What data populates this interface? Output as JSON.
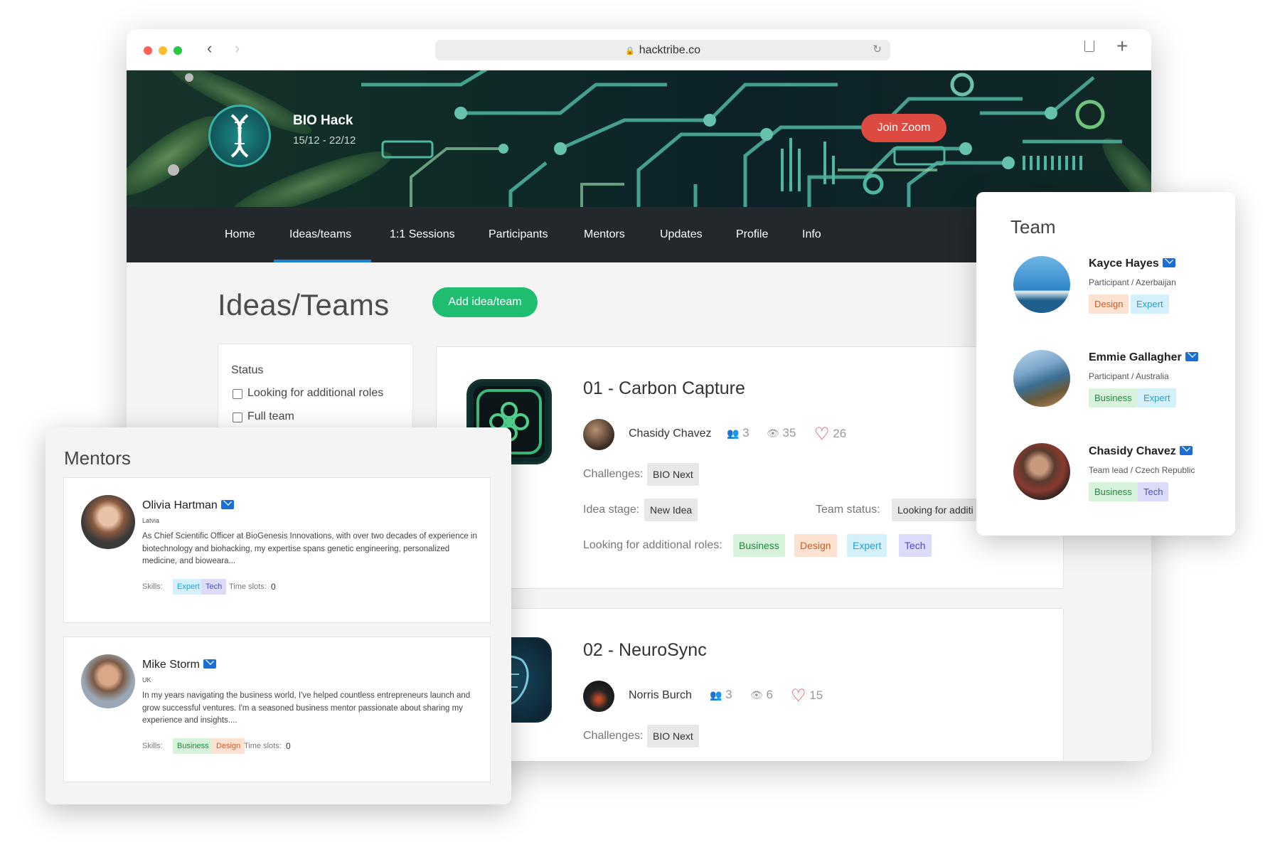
{
  "browser": {
    "url": "hacktribe.co"
  },
  "event": {
    "name": "BIO Hack",
    "dates": "15/12 - 22/12",
    "join_button": "Join Zoom"
  },
  "nav": [
    "Home",
    "Ideas/teams",
    "1:1 Sessions",
    "Participants",
    "Mentors",
    "Updates",
    "Profile",
    "Info"
  ],
  "nav_active": "Ideas/teams",
  "page": {
    "title": "Ideas/Teams",
    "add_button": "Add idea/team"
  },
  "filter": {
    "heading": "Status",
    "options": [
      "Looking for additional roles",
      "Full team"
    ]
  },
  "projects": [
    {
      "title": "01 - Carbon Capture",
      "owner": "Chasidy Chavez",
      "members": "3",
      "views": "35",
      "likes": "26",
      "challenges_label": "Challenges:",
      "challenge": "BIO Next",
      "stage_label": "Idea stage:",
      "stage": "New Idea",
      "status_label": "Team status:",
      "status": "Looking for additi",
      "roles_label": "Looking for additional roles:",
      "roles": [
        "Business",
        "Design",
        "Expert",
        "Tech"
      ]
    },
    {
      "title": "02 - NeuroSync",
      "owner": "Norris Burch",
      "members": "3",
      "views": "6",
      "likes": "15",
      "challenges_label": "Challenges:",
      "challenge": "BIO Next"
    }
  ],
  "mentors": {
    "title": "Mentors",
    "items": [
      {
        "name": "Olivia Hartman",
        "country": "Latvia",
        "bio": "As Chief Scientific Officer at BioGenesis Innovations, with over two decades of experience in biotechnology and biohacking, my expertise spans genetic engineering, personalized medicine, and bioweara...",
        "skills_label": "Skills:",
        "skills": [
          "Expert",
          "Tech"
        ],
        "slots_label": "Time slots:",
        "slots": "0"
      },
      {
        "name": "Mike Storm",
        "country": "UK",
        "bio": "In my years navigating the business world, I've helped countless entrepreneurs launch and grow successful ventures. I'm a seasoned business mentor passionate about sharing my experience and insights....",
        "skills_label": "Skills:",
        "skills": [
          "Business",
          "Design"
        ],
        "slots_label": "Time slots:",
        "slots": "0"
      }
    ]
  },
  "team": {
    "title": "Team",
    "members": [
      {
        "name": "Kayce Hayes",
        "role": "Participant / Azerbaijan",
        "tags": [
          "Design",
          "Expert"
        ]
      },
      {
        "name": "Emmie Gallagher",
        "role": "Participant / Australia",
        "tags": [
          "Business",
          "Expert"
        ]
      },
      {
        "name": "Chasidy Chavez",
        "role": "Team lead / Czech Republic",
        "tags": [
          "Business",
          "Tech"
        ]
      }
    ]
  },
  "colors": {
    "accent_green": "#1ebd6f",
    "zoom_red": "#dc4a42",
    "heart_red": "#e0262b",
    "nav_bg": "#22282b",
    "mail_blue": "#1a6ed8"
  }
}
